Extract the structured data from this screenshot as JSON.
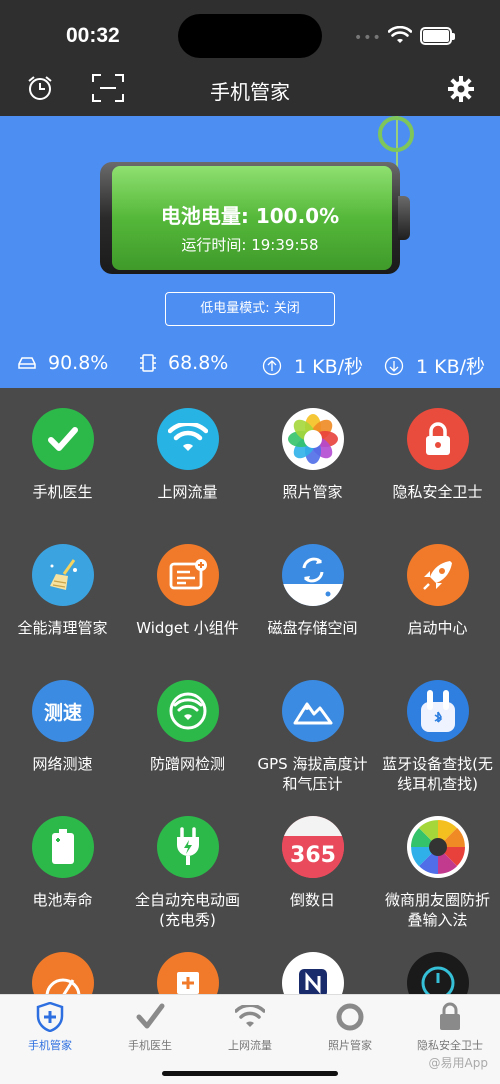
{
  "status_bar": {
    "time": "00:32",
    "dots": "•••"
  },
  "nav": {
    "title": "手机管家"
  },
  "battery": {
    "level_text": "电池电量: 100.0%",
    "uptime_text": "运行时间: 19:39:58",
    "level": 1.0
  },
  "low_power_mode": {
    "label": "低电量模式: 关闭"
  },
  "stats": {
    "disk": "90.8%",
    "memory": "68.8%",
    "upload": "1 KB/秒",
    "download": "1 KB/秒"
  },
  "apps": [
    {
      "label": "手机医生",
      "icon": "check-icon",
      "color": "#2db84a"
    },
    {
      "label": "上网流量",
      "icon": "wifi-icon",
      "color": "#27b3e3"
    },
    {
      "label": "照片管家",
      "icon": "photos-icon",
      "color": "#ffffff"
    },
    {
      "label": "隐私安全卫士",
      "icon": "lock-icon",
      "color": "#e94b3c"
    },
    {
      "label": "全能清理管家",
      "icon": "broom-icon",
      "color": "#3ba3e0"
    },
    {
      "label": "Widget 小组件",
      "icon": "widget-icon",
      "color": "#f07a2a"
    },
    {
      "label": "磁盘存储空间",
      "icon": "disk-icon",
      "color": "#3b8be2"
    },
    {
      "label": "启动中心",
      "icon": "rocket-icon",
      "color": "#f07a2a"
    },
    {
      "label": "网络测速",
      "icon": "speedtest-icon",
      "color": "#3b8be2",
      "text": "测速"
    },
    {
      "label": "防蹭网检测",
      "icon": "wifi-shield-icon",
      "color": "#2db84a"
    },
    {
      "label": "GPS 海拔高度计和气压计",
      "icon": "mountain-icon",
      "color": "#3b8be2"
    },
    {
      "label": "蓝牙设备查找(无线耳机查找)",
      "icon": "earbuds-icon",
      "color": "#2e7fe0"
    },
    {
      "label": "电池寿命",
      "icon": "battery-icon",
      "color": "#2db84a"
    },
    {
      "label": "全自动充电动画 (充电秀)",
      "icon": "plug-icon",
      "color": "#2db84a"
    },
    {
      "label": "倒数日",
      "icon": "calendar-icon",
      "color": "#e94b5c",
      "text": "365"
    },
    {
      "label": "微商朋友圈防折叠输入法",
      "icon": "aperture-icon",
      "color": "#ffffff"
    },
    {
      "label": "",
      "icon": "speedometer-icon",
      "color": "#f07a2a"
    },
    {
      "label": "",
      "icon": "chip-icon",
      "color": "#f07a2a"
    },
    {
      "label": "",
      "icon": "nfc-icon",
      "color": "#ffffff"
    },
    {
      "label": "",
      "icon": "power-icon",
      "color": "#1a1a1a"
    }
  ],
  "tabs": [
    {
      "label": "手机管家",
      "active": true,
      "icon": "shield-plus-icon"
    },
    {
      "label": "手机医生",
      "active": false,
      "icon": "check-icon"
    },
    {
      "label": "上网流量",
      "active": false,
      "icon": "wifi-icon"
    },
    {
      "label": "照片管家",
      "active": false,
      "icon": "ring-icon"
    },
    {
      "label": "隐私安全卫士",
      "active": false,
      "icon": "lock-icon"
    }
  ],
  "watermark": "@易用App",
  "colors": {
    "header_blue": "#4c8ef2",
    "active_tab": "#2d6fe0",
    "grid_bg": "#4a4a4a"
  }
}
